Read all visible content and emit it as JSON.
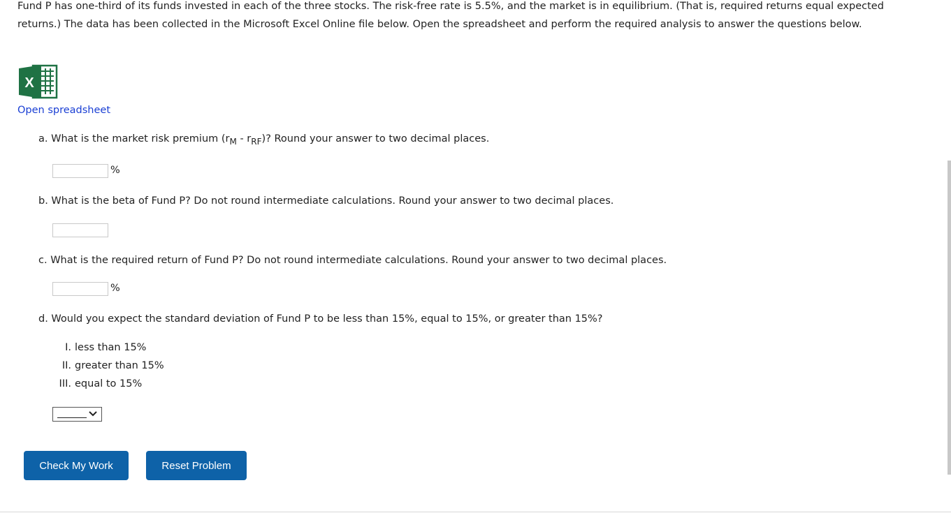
{
  "intro": {
    "text": "Fund P has one-third of its funds invested in each of the three stocks. The risk-free rate is 5.5%, and the market is in equilibrium. (That is, required returns equal expected returns.) The data has been collected in the Microsoft Excel Online file below. Open the spreadsheet and perform the required analysis to answer the questions below."
  },
  "spreadsheet": {
    "icon": "excel-icon",
    "icon_letter": "X",
    "link_label": "Open spreadsheet"
  },
  "questions": {
    "a": {
      "text_before": "a. What is the market risk premium (r",
      "sub1": "M",
      "text_mid": " - r",
      "sub2": "RF",
      "text_after": ")? Round your answer to two decimal places.",
      "value": "",
      "unit": "%"
    },
    "b": {
      "text": "b. What is the beta of Fund P? Do not round intermediate calculations. Round your answer to two decimal places.",
      "value": ""
    },
    "c": {
      "text": "c. What is the required return of Fund P? Do not round intermediate calculations. Round your answer to two decimal places.",
      "value": "",
      "unit": "%"
    },
    "d": {
      "text": "d. Would you expect the standard deviation of Fund P to be less than 15%, equal to 15%, or greater than 15%?",
      "options": [
        {
          "num": "I.",
          "label": "less than 15%"
        },
        {
          "num": "II.",
          "label": "greater than 15%"
        },
        {
          "num": "III.",
          "label": "equal to 15%"
        }
      ],
      "selected": ""
    }
  },
  "buttons": {
    "check": "Check My Work",
    "reset": "Reset Problem"
  },
  "colors": {
    "button": "#0e62a8",
    "link": "#1a3fd4",
    "excel_green": "#1f7244"
  }
}
